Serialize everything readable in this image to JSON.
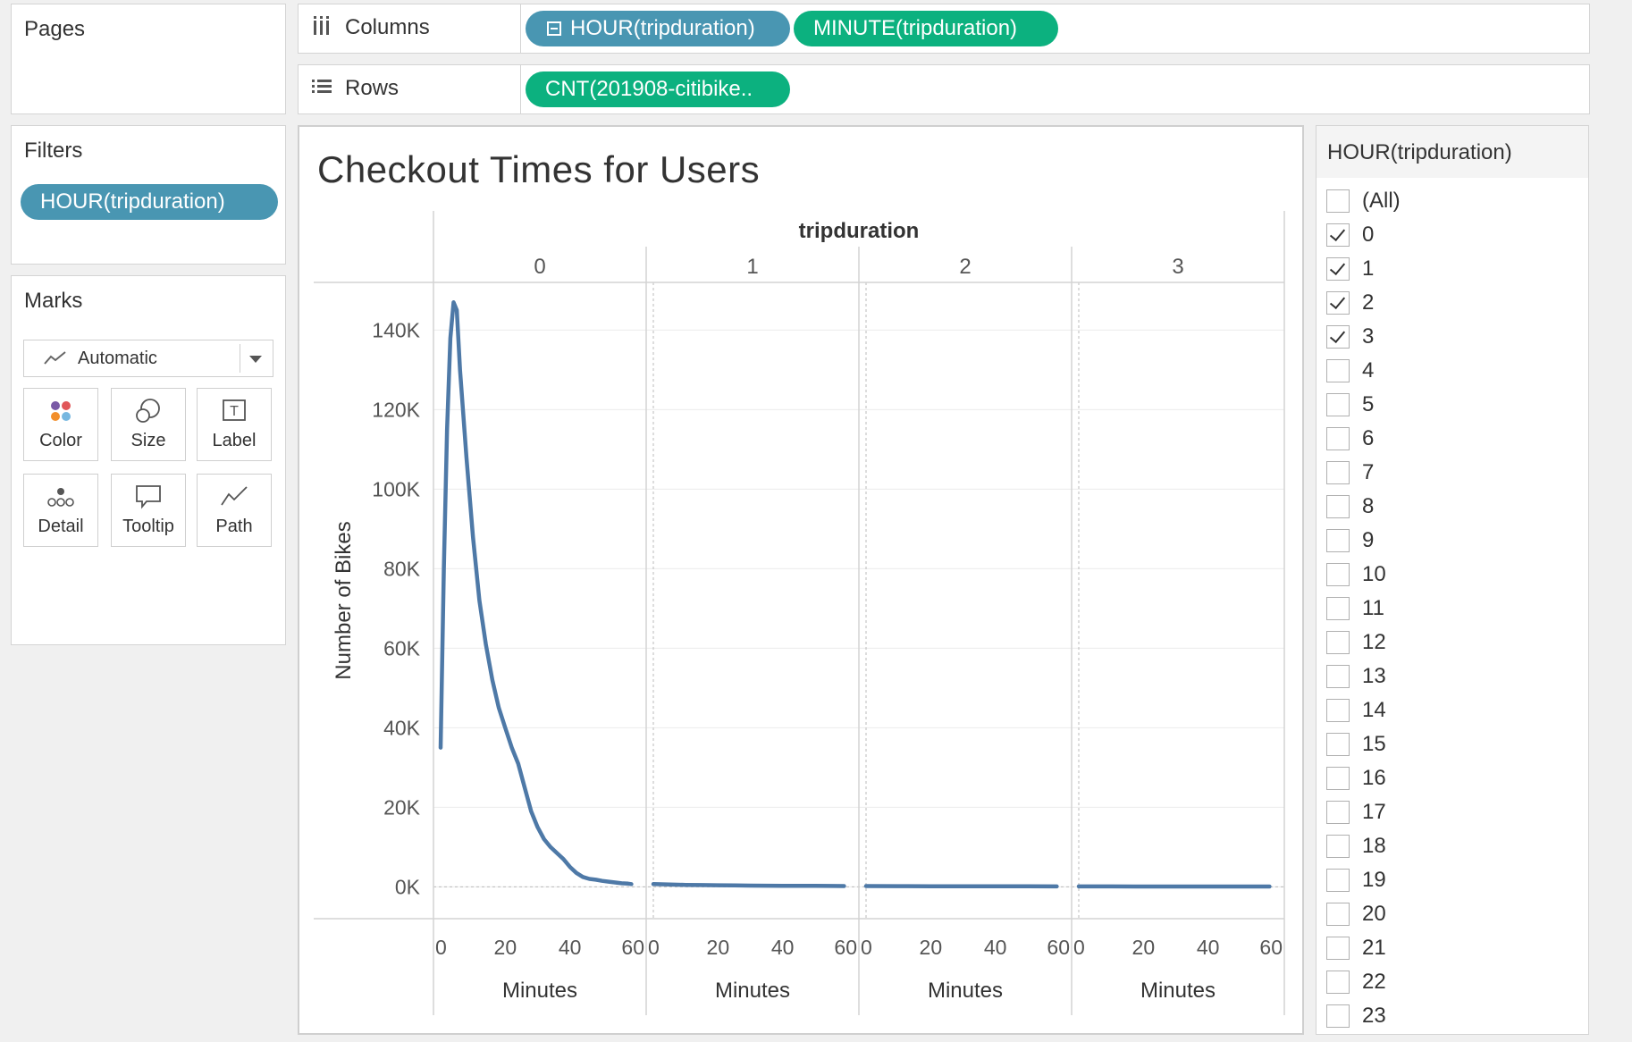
{
  "pages": {
    "title": "Pages"
  },
  "columns_shelf": {
    "label": "Columns",
    "pills": [
      "HOUR(tripduration)",
      "MINUTE(tripduration)"
    ]
  },
  "rows_shelf": {
    "label": "Rows",
    "pills": [
      "CNT(201908-citibike.."
    ]
  },
  "filters": {
    "title": "Filters",
    "pill": "HOUR(tripduration)"
  },
  "marks": {
    "title": "Marks",
    "type": "Automatic",
    "buttons": [
      "Color",
      "Size",
      "Label",
      "Detail",
      "Tooltip",
      "Path"
    ]
  },
  "filter_card": {
    "title": "HOUR(tripduration)",
    "items": [
      {
        "label": "(All)",
        "checked": false
      },
      {
        "label": "0",
        "checked": true
      },
      {
        "label": "1",
        "checked": true
      },
      {
        "label": "2",
        "checked": true
      },
      {
        "label": "3",
        "checked": true
      },
      {
        "label": "4",
        "checked": false
      },
      {
        "label": "5",
        "checked": false
      },
      {
        "label": "6",
        "checked": false
      },
      {
        "label": "7",
        "checked": false
      },
      {
        "label": "8",
        "checked": false
      },
      {
        "label": "9",
        "checked": false
      },
      {
        "label": "10",
        "checked": false
      },
      {
        "label": "11",
        "checked": false
      },
      {
        "label": "12",
        "checked": false
      },
      {
        "label": "13",
        "checked": false
      },
      {
        "label": "14",
        "checked": false
      },
      {
        "label": "15",
        "checked": false
      },
      {
        "label": "16",
        "checked": false
      },
      {
        "label": "17",
        "checked": false
      },
      {
        "label": "18",
        "checked": false
      },
      {
        "label": "19",
        "checked": false
      },
      {
        "label": "20",
        "checked": false
      },
      {
        "label": "21",
        "checked": false
      },
      {
        "label": "22",
        "checked": false
      },
      {
        "label": "23",
        "checked": false
      }
    ]
  },
  "colors": {
    "line": "#4e79a7",
    "pill_blue": "#4996b2",
    "pill_green": "#0cb17f"
  },
  "chart_data": {
    "type": "line",
    "title": "Checkout Times for Users",
    "column_header": "tripduration",
    "panels": [
      "0",
      "1",
      "2",
      "3"
    ],
    "xlabel": "Minutes",
    "ylabel": "Number of Bikes",
    "xticks": [
      "0",
      "20",
      "40",
      "60"
    ],
    "xlim": [
      0,
      60
    ],
    "ylim": [
      -8000,
      152000
    ],
    "yticks": [
      "0K",
      "20K",
      "40K",
      "60K",
      "80K",
      "100K",
      "120K",
      "140K"
    ],
    "grid": true,
    "series": [
      {
        "panel": "0",
        "x": [
          0,
          1,
          2,
          3,
          4,
          5,
          6,
          8,
          10,
          12,
          14,
          16,
          18,
          20,
          22,
          24,
          26,
          28,
          30,
          32,
          34,
          36,
          38,
          40,
          42,
          44,
          46,
          48,
          50,
          52,
          54,
          56,
          58,
          59
        ],
        "y": [
          35000,
          80000,
          115000,
          138000,
          147000,
          145000,
          130000,
          108000,
          88000,
          72000,
          61000,
          52000,
          45000,
          40000,
          35000,
          31000,
          25000,
          19000,
          15000,
          12000,
          10000,
          8500,
          7000,
          5000,
          3500,
          2500,
          2000,
          1800,
          1500,
          1300,
          1100,
          900,
          800,
          700
        ]
      },
      {
        "panel": "1",
        "x": [
          0,
          5,
          10,
          15,
          20,
          25,
          30,
          35,
          40,
          45,
          50,
          55,
          59
        ],
        "y": [
          700,
          600,
          500,
          450,
          400,
          350,
          320,
          300,
          280,
          260,
          240,
          220,
          200
        ]
      },
      {
        "panel": "2",
        "x": [
          0,
          10,
          20,
          30,
          40,
          50,
          59
        ],
        "y": [
          200,
          180,
          160,
          150,
          140,
          130,
          120
        ]
      },
      {
        "panel": "3",
        "x": [
          0,
          10,
          20,
          30,
          40,
          50,
          59
        ],
        "y": [
          120,
          110,
          100,
          95,
          90,
          85,
          80
        ]
      }
    ]
  }
}
